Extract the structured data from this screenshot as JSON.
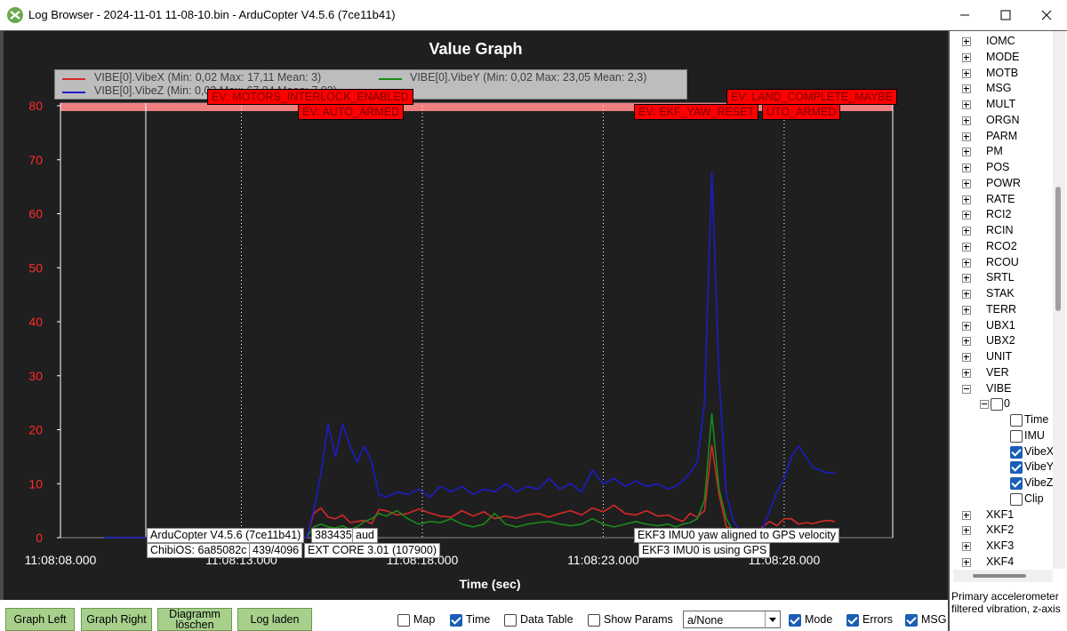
{
  "window": {
    "title": "Log Browser - 2024-11-01 11-08-10.bin - ArduCopter V4.5.6 (7ce11b41)"
  },
  "graph": {
    "title": "Value Graph",
    "legend": [
      {
        "label": "VIBE[0].VibeX  (Min: 0,02 Max: 17,11 Mean: 3)",
        "color": "#d62828"
      },
      {
        "label": "VIBE[0].VibeY  (Min: 0,02 Max: 23,05 Mean: 2,3)",
        "color": "#1a8a1a"
      },
      {
        "label": "VIBE[0].VibeZ  (Min: 0,02 Max: 67,84 Mean: 7,03)",
        "color": "#1c1cc8"
      }
    ],
    "events": [
      "EV: MOTORS_INTERLOCK_ENABLED",
      "EV: AUTO_ARMED",
      "EV: EKF_YAW_RESET",
      "UTO_ARMED",
      "EV: LAND_COMPLETE_MAYBE"
    ],
    "messages": [
      "ArduCopter V4.5.6 (7ce11b41)",
      "383435",
      "aud",
      "ChibiOS: 6a85082c",
      "439/4096",
      "EXT CORE 3.01 (107900)",
      "EKF3 IMU0 yaw aligned to GPS velocity",
      "EKF3 IMU0 is using GPS"
    ]
  },
  "chart_data": {
    "type": "line",
    "title": "Value Graph",
    "xlabel": "Time (sec)",
    "ylabel": "",
    "x_tick_labels": [
      "11:08:08.000",
      "11:08:13.000",
      "11:08:18.000",
      "11:08:23.000",
      "11:08:28.000"
    ],
    "x_ticks": [
      0,
      5,
      10,
      15,
      20
    ],
    "y_ticks": [
      0,
      10,
      20,
      30,
      40,
      50,
      60,
      70,
      80
    ],
    "xlim": [
      0,
      23
    ],
    "ylim": [
      0,
      80
    ],
    "grid": "vertical dotted",
    "x": [
      1.2,
      2.5,
      4.0,
      6.8,
      7.0,
      7.2,
      7.4,
      7.6,
      7.8,
      8.0,
      8.2,
      8.4,
      8.6,
      8.8,
      9.0,
      9.3,
      9.6,
      9.9,
      10.2,
      10.5,
      10.8,
      11.1,
      11.4,
      11.7,
      12.0,
      12.3,
      12.6,
      12.9,
      13.2,
      13.5,
      13.8,
      14.1,
      14.4,
      14.7,
      15.0,
      15.3,
      15.6,
      15.9,
      16.2,
      16.5,
      16.8,
      17.0,
      17.2,
      17.4,
      17.6,
      17.8,
      18.0,
      18.2,
      18.4,
      18.6,
      18.8,
      19.0,
      19.2,
      19.4,
      19.6,
      19.8,
      20.0,
      20.2,
      20.4,
      20.6,
      20.8,
      21.0,
      21.2,
      21.4
    ],
    "series": [
      {
        "name": "VIBE[0].VibeX",
        "color": "#d62828",
        "values": [
          0.02,
          0.02,
          0.02,
          0.02,
          4.5,
          5.5,
          3.8,
          3.5,
          4.2,
          2.8,
          3.0,
          3.2,
          2.6,
          5.2,
          5.0,
          4.2,
          4.5,
          5.3,
          4.6,
          4.0,
          3.8,
          5.0,
          4.0,
          4.8,
          3.5,
          4.0,
          3.6,
          4.2,
          4.5,
          3.8,
          4.5,
          5.0,
          4.2,
          5.5,
          4.8,
          6.0,
          4.5,
          4.2,
          5.0,
          4.0,
          4.2,
          3.5,
          3.0,
          4.5,
          3.8,
          5.0,
          17.1,
          8.0,
          2.0,
          1.5,
          0.5,
          0.3,
          0.5,
          2.0,
          3.0,
          2.2,
          3.5,
          3.5,
          2.5,
          2.8,
          2.6,
          3.0,
          3.2,
          3.0
        ]
      },
      {
        "name": "VIBE[0].VibeY",
        "color": "#1a8a1a",
        "values": [
          0.02,
          0.02,
          0.02,
          0.02,
          2.0,
          2.5,
          2.0,
          1.8,
          2.2,
          1.5,
          2.0,
          3.0,
          3.5,
          4.5,
          4.0,
          5.0,
          3.5,
          2.5,
          3.0,
          2.8,
          3.5,
          2.5,
          2.0,
          2.5,
          4.5,
          2.5,
          2.0,
          2.5,
          2.8,
          3.0,
          2.5,
          2.2,
          2.5,
          3.5,
          2.5,
          2.0,
          2.5,
          3.0,
          2.5,
          2.2,
          2.5,
          2.0,
          2.5,
          2.8,
          3.5,
          7.0,
          23.0,
          9.0,
          3.5,
          1.0,
          0.5,
          0.3,
          0.2,
          0.2,
          0.2,
          0.3,
          0.2,
          0.2,
          0.2,
          0.2,
          0.2,
          0.2,
          0.2,
          0.2
        ]
      },
      {
        "name": "VIBE[0].VibeZ",
        "color": "#1c1cc8",
        "values": [
          0.02,
          0.02,
          0.02,
          0.02,
          5.0,
          12.0,
          21.0,
          15.0,
          21.0,
          17.0,
          14.0,
          17.0,
          14.0,
          8.0,
          7.5,
          8.5,
          8.0,
          9.0,
          7.5,
          9.5,
          8.5,
          9.5,
          8.0,
          9.0,
          8.5,
          10.0,
          8.5,
          9.5,
          9.0,
          11.0,
          9.0,
          10.0,
          8.5,
          12.5,
          10.0,
          11.0,
          9.5,
          10.5,
          9.5,
          10.0,
          9.0,
          9.5,
          10.5,
          12.0,
          14.0,
          25.0,
          67.8,
          30.0,
          8.0,
          3.0,
          1.0,
          0.5,
          0.5,
          1.5,
          5.0,
          8.5,
          11.0,
          15.0,
          17.0,
          15.0,
          13.0,
          12.5,
          12.0,
          12.0
        ]
      }
    ]
  },
  "sidebar": {
    "tree": [
      {
        "label": "IOMC",
        "expander": "plus"
      },
      {
        "label": "MODE",
        "expander": "plus"
      },
      {
        "label": "MOTB",
        "expander": "plus"
      },
      {
        "label": "MSG",
        "expander": "plus"
      },
      {
        "label": "MULT",
        "expander": "plus"
      },
      {
        "label": "ORGN",
        "expander": "plus"
      },
      {
        "label": "PARM",
        "expander": "plus"
      },
      {
        "label": "PM",
        "expander": "plus"
      },
      {
        "label": "POS",
        "expander": "plus"
      },
      {
        "label": "POWR",
        "expander": "plus"
      },
      {
        "label": "RATE",
        "expander": "plus"
      },
      {
        "label": "RCI2",
        "expander": "plus"
      },
      {
        "label": "RCIN",
        "expander": "plus"
      },
      {
        "label": "RCO2",
        "expander": "plus"
      },
      {
        "label": "RCOU",
        "expander": "plus"
      },
      {
        "label": "SRTL",
        "expander": "plus"
      },
      {
        "label": "STAK",
        "expander": "plus"
      },
      {
        "label": "TERR",
        "expander": "plus"
      },
      {
        "label": "UBX1",
        "expander": "plus"
      },
      {
        "label": "UBX2",
        "expander": "plus"
      },
      {
        "label": "UNIT",
        "expander": "plus"
      },
      {
        "label": "VER",
        "expander": "plus"
      },
      {
        "label": "VIBE",
        "expander": "minus"
      }
    ],
    "vibe_instance": "0",
    "vibe_fields": [
      {
        "label": "Time",
        "checked": false
      },
      {
        "label": "IMU",
        "checked": false
      },
      {
        "label": "VibeX",
        "checked": true
      },
      {
        "label": "VibeY",
        "checked": true
      },
      {
        "label": "VibeZ",
        "checked": true
      },
      {
        "label": "Clip",
        "checked": false
      }
    ],
    "tree_after": [
      {
        "label": "XKF1",
        "expander": "plus"
      },
      {
        "label": "XKF2",
        "expander": "plus"
      },
      {
        "label": "XKF3",
        "expander": "plus"
      },
      {
        "label": "XKF4",
        "expander": "plus"
      }
    ],
    "description": "Primary accelerometer filtered vibration, z-axis"
  },
  "bottom": {
    "buttons": [
      {
        "label": "Graph Left"
      },
      {
        "label": "Graph Right"
      },
      {
        "label": "Diagramm löschen"
      },
      {
        "label": "Log laden"
      }
    ],
    "checkboxes": [
      {
        "label": "Map",
        "checked": false
      },
      {
        "label": "Time",
        "checked": true
      },
      {
        "label": "Data Table",
        "checked": false
      },
      {
        "label": "Show Params",
        "checked": false
      },
      {
        "label": "Mode",
        "checked": true
      },
      {
        "label": "Errors",
        "checked": true
      },
      {
        "label": "MSG",
        "checked": true
      }
    ],
    "combo_value": "a/None"
  }
}
